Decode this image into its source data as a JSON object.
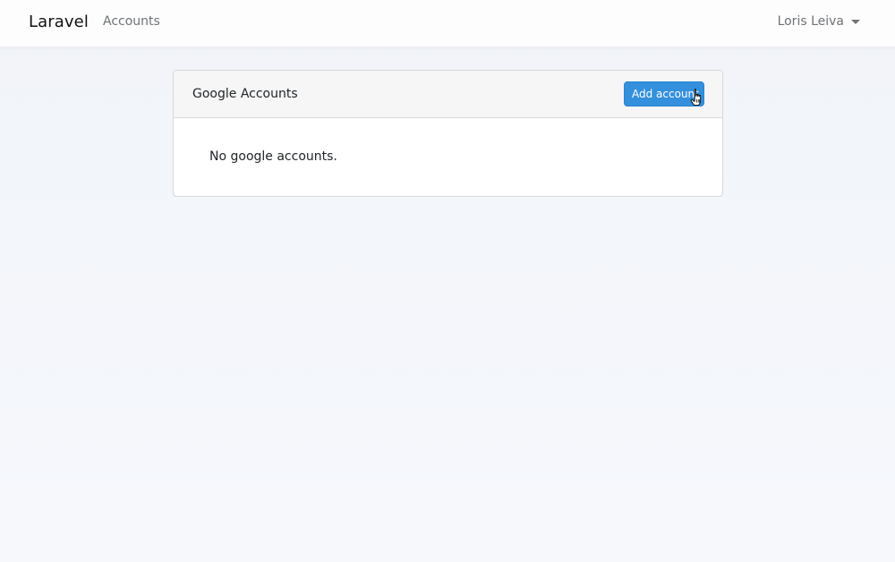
{
  "navbar": {
    "brand": "Laravel",
    "nav_link": "Accounts",
    "user_name": "Loris Leiva"
  },
  "card": {
    "title": "Google Accounts",
    "add_button_label": "Add account",
    "empty_message": "No google accounts."
  },
  "colors": {
    "primary": "#3490dc",
    "page_background": "#f3f6fa"
  },
  "icons": {
    "user_dropdown": "caret-down-icon",
    "pointer": "hand-pointer-icon"
  }
}
